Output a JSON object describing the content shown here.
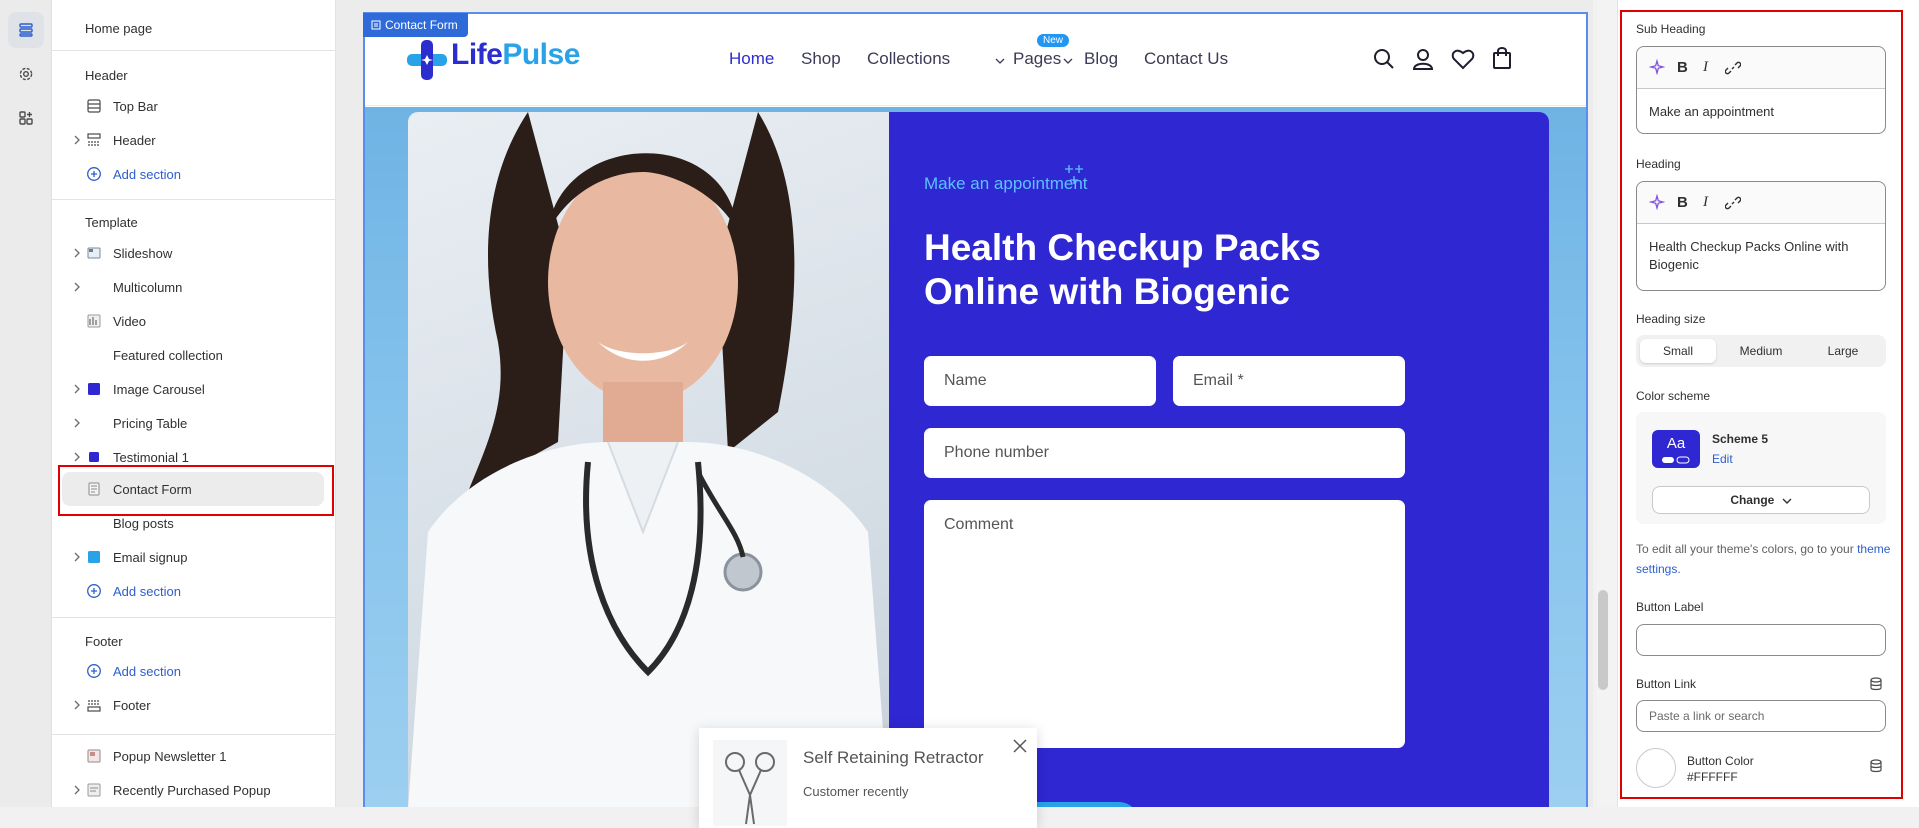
{
  "rail": {
    "icons": [
      "sections-icon",
      "settings-icon",
      "apps-icon"
    ]
  },
  "sidebar": {
    "page_title": "Home page",
    "header_group": {
      "title": "Header",
      "items": [
        "Top Bar",
        "Header"
      ],
      "add_label": "Add section"
    },
    "template_group": {
      "title": "Template",
      "items": [
        "Slideshow",
        "Multicolumn",
        "Video",
        "Featured collection",
        "Image Carousel",
        "Pricing Table",
        "Testimonial 1",
        "Contact Form",
        "Blog posts",
        "Email signup"
      ],
      "add_label": "Add section"
    },
    "footer_group": {
      "title": "Footer",
      "add_label": "Add section",
      "items": [
        "Footer"
      ]
    },
    "overlay_items": [
      "Popup Newsletter 1",
      "Recently Purchased Popup"
    ]
  },
  "canvas": {
    "frame_tag": "Contact Form",
    "logo_left": "Life",
    "logo_right": "Pulse",
    "nav": [
      "Home",
      "Shop",
      "Collections",
      "Pages",
      "Blog",
      "Contact Us"
    ],
    "new_badge": "New",
    "sub_heading": "Make an appointment",
    "heading": "Health Checkup Packs Online with Biogenic",
    "form": {
      "name": "Name",
      "email": "Email *",
      "phone": "Phone number",
      "comment": "Comment"
    },
    "popup": {
      "title": "Self Retaining Retractor",
      "text": "Customer recently"
    }
  },
  "inspector": {
    "sub_heading_label": "Sub Heading",
    "sub_heading_value": "Make an appointment",
    "heading_label": "Heading",
    "heading_value": "Health Checkup Packs Online  with Biogenic",
    "heading_size_label": "Heading size",
    "sizes": [
      "Small",
      "Medium",
      "Large"
    ],
    "selected_size": "Small",
    "color_scheme_label": "Color scheme",
    "scheme_preview": "Aa",
    "scheme_name": "Scheme 5",
    "scheme_edit": "Edit",
    "change_label": "Change",
    "help_text": "To edit all your theme's colors, go to your",
    "help_link": "theme settings.",
    "button_label_label": "Button Label",
    "button_label_value": "",
    "button_link_label": "Button Link",
    "button_link_placeholder": "Paste a link or search",
    "button_color_label": "Button Color",
    "button_color_value": "#FFFFFF"
  },
  "colors": {
    "brand": "#2c2dcf",
    "accent": "#29a3e8",
    "panel_purple": "#2f27d1",
    "highlight": "#e00000"
  }
}
